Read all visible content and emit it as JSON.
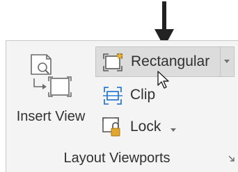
{
  "ribbon_panel": {
    "insert_view": {
      "label": "Insert View",
      "icon": "insert-view-icon"
    },
    "rectangular": {
      "label": "Rectangular",
      "icon": "rectangular-viewport-icon",
      "state": "hovered"
    },
    "clip": {
      "label": "Clip",
      "icon": "clip-viewport-icon"
    },
    "lock": {
      "label": "Lock",
      "icon": "lock-viewport-icon"
    },
    "group_label": "Layout Viewports"
  },
  "annotation": {
    "arrow_icon": "down-arrow-icon",
    "cursor_icon": "mouse-pointer-icon"
  },
  "colors": {
    "panel_bg": "#f4f4f4",
    "hover_bg": "#dcdcdc",
    "accent_blue": "#2d7bd6",
    "lock_gold": "#e0a630",
    "text": "#303030"
  }
}
